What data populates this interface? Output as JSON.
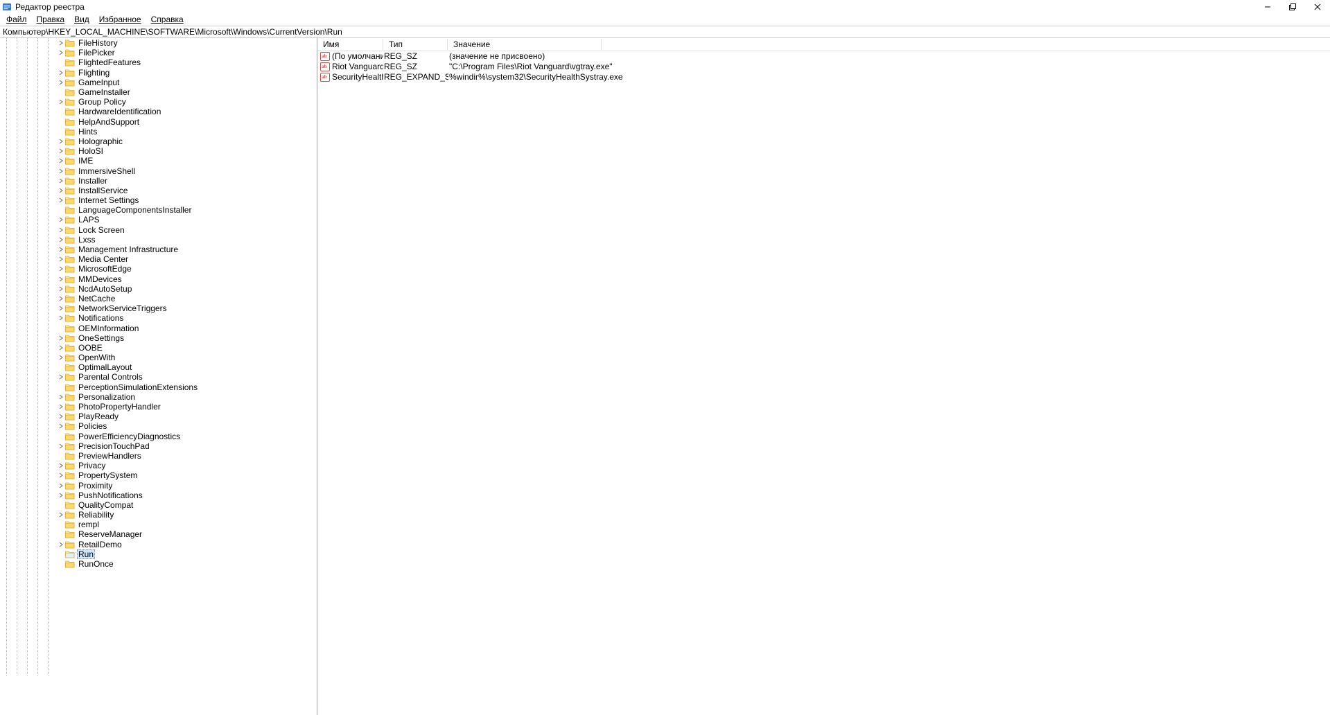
{
  "window": {
    "title": "Редактор реестра"
  },
  "menu": {
    "file": "Файл",
    "edit": "Правка",
    "view": "Вид",
    "favorites": "Избранное",
    "help": "Справка"
  },
  "address": "Компьютер\\HKEY_LOCAL_MACHINE\\SOFTWARE\\Microsoft\\Windows\\CurrentVersion\\Run",
  "columns": {
    "name": "Имя",
    "type": "Тип",
    "value": "Значение"
  },
  "values": [
    {
      "name": "(По умолчанию)",
      "type": "REG_SZ",
      "value": "(значение не присвоено)"
    },
    {
      "name": "Riot Vanguard",
      "type": "REG_SZ",
      "value": "\"C:\\Program Files\\Riot Vanguard\\vgtray.exe\""
    },
    {
      "name": "SecurityHealth",
      "type": "REG_EXPAND_SZ",
      "value": "%windir%\\system32\\SecurityHealthSystray.exe"
    }
  ],
  "tree": [
    {
      "name": "FileHistory",
      "exp": true
    },
    {
      "name": "FilePicker",
      "exp": true
    },
    {
      "name": "FlightedFeatures",
      "exp": false
    },
    {
      "name": "Flighting",
      "exp": true
    },
    {
      "name": "GameInput",
      "exp": true
    },
    {
      "name": "GameInstaller",
      "exp": false
    },
    {
      "name": "Group Policy",
      "exp": true
    },
    {
      "name": "HardwareIdentification",
      "exp": false
    },
    {
      "name": "HelpAndSupport",
      "exp": false
    },
    {
      "name": "Hints",
      "exp": false
    },
    {
      "name": "Holographic",
      "exp": true
    },
    {
      "name": "HoloSI",
      "exp": true
    },
    {
      "name": "IME",
      "exp": true
    },
    {
      "name": "ImmersiveShell",
      "exp": true
    },
    {
      "name": "Installer",
      "exp": true
    },
    {
      "name": "InstallService",
      "exp": true
    },
    {
      "name": "Internet Settings",
      "exp": true
    },
    {
      "name": "LanguageComponentsInstaller",
      "exp": false
    },
    {
      "name": "LAPS",
      "exp": true
    },
    {
      "name": "Lock Screen",
      "exp": true
    },
    {
      "name": "Lxss",
      "exp": true
    },
    {
      "name": "Management Infrastructure",
      "exp": true
    },
    {
      "name": "Media Center",
      "exp": true
    },
    {
      "name": "MicrosoftEdge",
      "exp": true
    },
    {
      "name": "MMDevices",
      "exp": true
    },
    {
      "name": "NcdAutoSetup",
      "exp": true
    },
    {
      "name": "NetCache",
      "exp": true
    },
    {
      "name": "NetworkServiceTriggers",
      "exp": true
    },
    {
      "name": "Notifications",
      "exp": true
    },
    {
      "name": "OEMInformation",
      "exp": false
    },
    {
      "name": "OneSettings",
      "exp": true
    },
    {
      "name": "OOBE",
      "exp": true
    },
    {
      "name": "OpenWith",
      "exp": true
    },
    {
      "name": "OptimalLayout",
      "exp": false
    },
    {
      "name": "Parental Controls",
      "exp": true
    },
    {
      "name": "PerceptionSimulationExtensions",
      "exp": false
    },
    {
      "name": "Personalization",
      "exp": true
    },
    {
      "name": "PhotoPropertyHandler",
      "exp": true
    },
    {
      "name": "PlayReady",
      "exp": true
    },
    {
      "name": "Policies",
      "exp": true
    },
    {
      "name": "PowerEfficiencyDiagnostics",
      "exp": false
    },
    {
      "name": "PrecisionTouchPad",
      "exp": true
    },
    {
      "name": "PreviewHandlers",
      "exp": false
    },
    {
      "name": "Privacy",
      "exp": true
    },
    {
      "name": "PropertySystem",
      "exp": true
    },
    {
      "name": "Proximity",
      "exp": true
    },
    {
      "name": "PushNotifications",
      "exp": true
    },
    {
      "name": "QualityCompat",
      "exp": false
    },
    {
      "name": "Reliability",
      "exp": true
    },
    {
      "name": "rempl",
      "exp": false
    },
    {
      "name": "ReserveManager",
      "exp": false
    },
    {
      "name": "RetailDemo",
      "exp": true
    },
    {
      "name": "Run",
      "exp": false,
      "selected": true
    },
    {
      "name": "RunOnce",
      "exp": false
    }
  ]
}
